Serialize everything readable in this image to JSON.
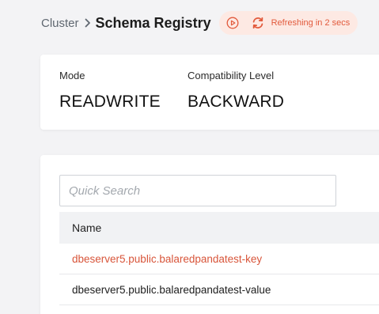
{
  "breadcrumb": {
    "parent": "Cluster",
    "current": "Schema Registry"
  },
  "refresh": {
    "status": "Refreshing in 2 secs"
  },
  "info": {
    "mode_label": "Mode",
    "mode_value": "READWRITE",
    "compat_label": "Compatibility Level",
    "compat_value": "BACKWARD"
  },
  "search": {
    "placeholder": "Quick Search",
    "value": ""
  },
  "table": {
    "columns": [
      "Name"
    ],
    "rows": [
      "dbeserver5.public.balaredpandatest-key",
      "dbeserver5.public.balaredpandatest-value"
    ]
  },
  "colors": {
    "accent": "#e25a3c",
    "link": "#d8553a",
    "pill_bg": "#fde9e3",
    "page_bg": "#f3f3f5"
  },
  "icons": [
    "chevron-right-icon",
    "play-icon",
    "refresh-icon"
  ]
}
